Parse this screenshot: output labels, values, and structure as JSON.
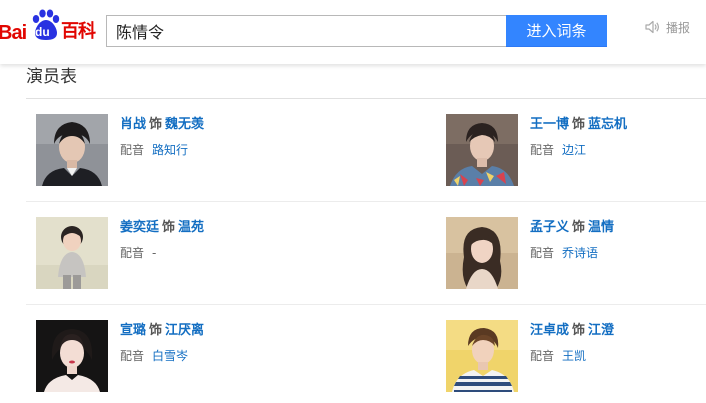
{
  "header": {
    "logo": {
      "bai": "Bai",
      "du": "du",
      "baike": "百科"
    },
    "search_value": "陈情令",
    "search_button": "进入词条",
    "audio_label": "播报",
    "icons": {
      "logo": "baidu-paw-icon",
      "audio": "speaker-icon"
    },
    "colors": {
      "brand": "#e10601",
      "button": "#3385ff",
      "link": "#136ec2"
    }
  },
  "section": {
    "title": "演员表"
  },
  "cast": [
    {
      "actor": "肖战",
      "as": "饰",
      "role": "魏无羡",
      "voice_label": "配音",
      "voice_actor": "路知行"
    },
    {
      "actor": "王一博",
      "as": "饰",
      "role": "蓝忘机",
      "voice_label": "配音",
      "voice_actor": "边江"
    },
    {
      "actor": "姜奕廷",
      "as": "饰",
      "role": "温苑",
      "voice_label": "配音",
      "voice_actor": "-"
    },
    {
      "actor": "孟子义",
      "as": "饰",
      "role": "温情",
      "voice_label": "配音",
      "voice_actor": "乔诗语"
    },
    {
      "actor": "宣璐",
      "as": "饰",
      "role": "江厌离",
      "voice_label": "配音",
      "voice_actor": "白雪岑"
    },
    {
      "actor": "汪卓成",
      "as": "饰",
      "role": "江澄",
      "voice_label": "配音",
      "voice_actor": "王凯"
    }
  ]
}
